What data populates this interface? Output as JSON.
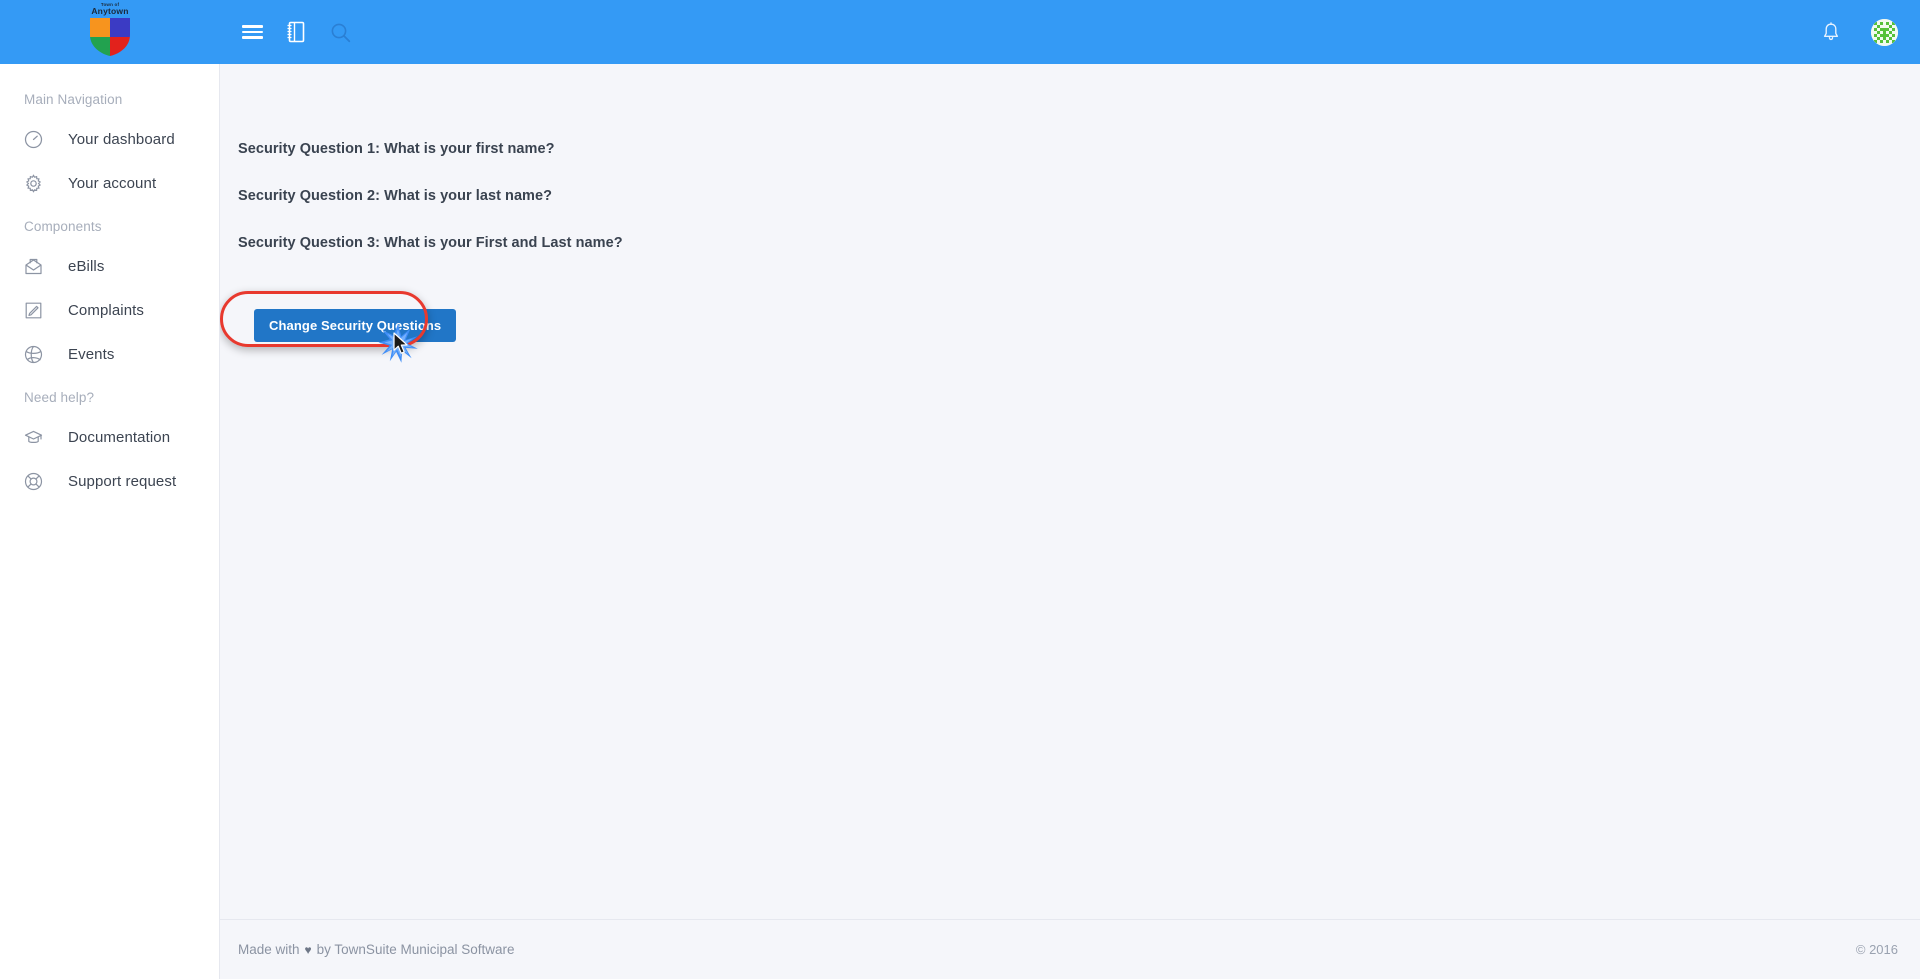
{
  "header": {
    "logo": {
      "line1": "Town of",
      "line2": "Anytown",
      "icon": "shield-logo",
      "colors": {
        "top_left": "#F7941E",
        "top_right": "#3B3BC4",
        "bottom_left": "#22A24F",
        "bottom_right": "#E2221C"
      }
    },
    "background_color": "#349AF5",
    "icons": {
      "menu": "hamburger-menu-icon",
      "notebook": "notebook-icon",
      "search": "search-icon",
      "notifications": "bell-icon",
      "avatar": "user-avatar"
    }
  },
  "sidebar": {
    "sections": [
      {
        "title": "Main Navigation",
        "items": [
          {
            "label": "Your dashboard",
            "icon": "dashboard-gauge-icon"
          },
          {
            "label": "Your account",
            "icon": "gear-icon"
          }
        ]
      },
      {
        "title": "Components",
        "items": [
          {
            "label": "eBills",
            "icon": "open-envelope-icon"
          },
          {
            "label": "Complaints",
            "icon": "pencil-square-icon"
          },
          {
            "label": "Events",
            "icon": "dribbble-ball-icon"
          }
        ]
      },
      {
        "title": "Need help?",
        "items": [
          {
            "label": "Documentation",
            "icon": "graduation-cap-icon"
          },
          {
            "label": "Support request",
            "icon": "life-ring-icon"
          }
        ]
      }
    ]
  },
  "main": {
    "questions": [
      "Security Question 1: What is your first name?",
      "Security Question 2: What is your last name?",
      "Security Question 3: What is your First and Last name?"
    ],
    "change_button_label": "Change Security Questions",
    "button_color": "#2176C7",
    "annotation_color": "#E8392E"
  },
  "footer": {
    "made_with_prefix": "Made with",
    "heart": "♥",
    "made_with_suffix": "by TownSuite Municipal Software",
    "copyright": "© 2016"
  }
}
